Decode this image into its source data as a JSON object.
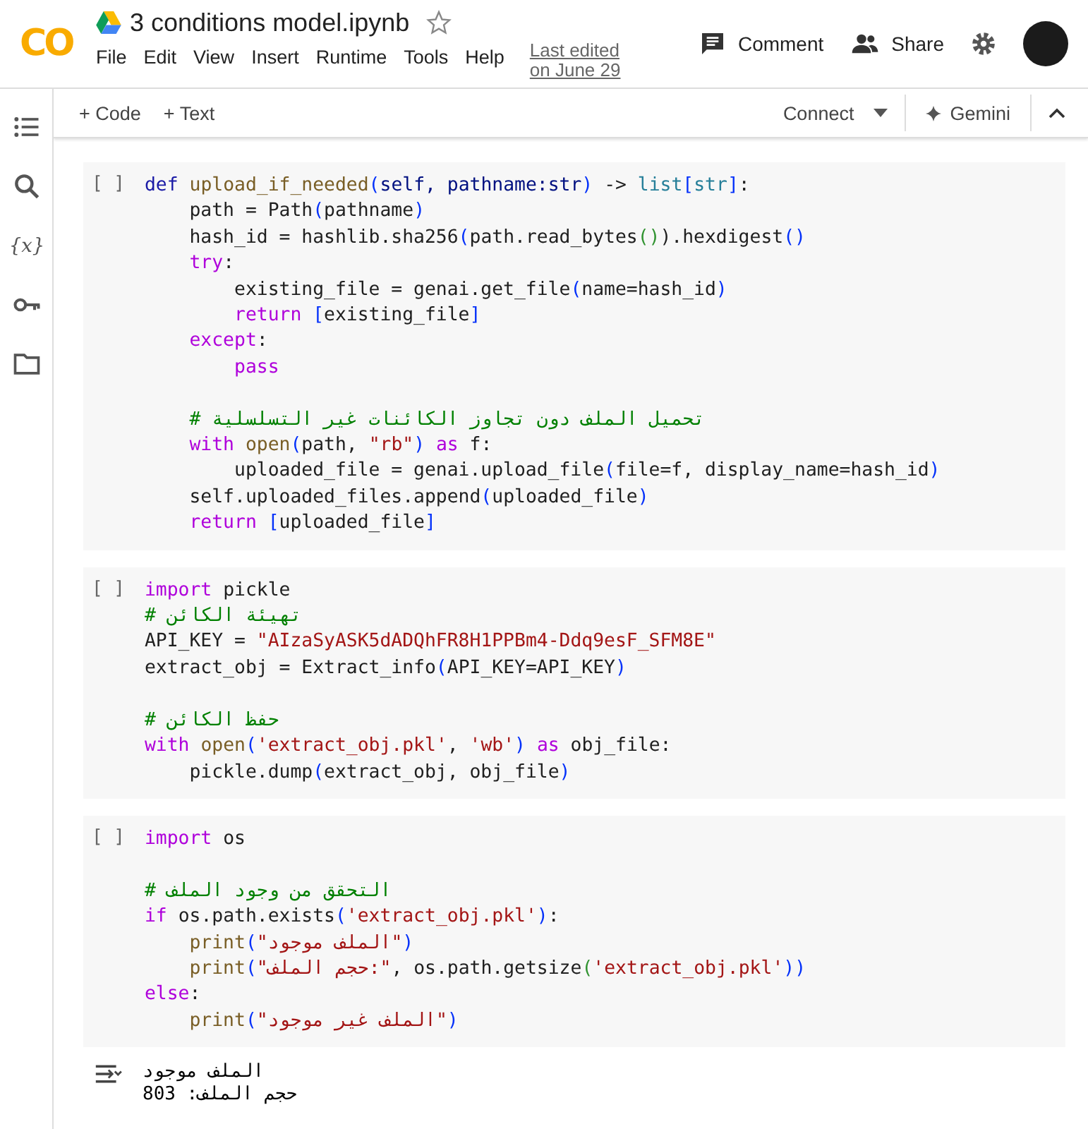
{
  "header": {
    "logo": "CO",
    "title": "3 conditions model.ipynb",
    "starred": false,
    "menu": [
      "File",
      "Edit",
      "View",
      "Insert",
      "Runtime",
      "Tools",
      "Help"
    ],
    "last_edited": [
      "Last edited",
      "on June 29"
    ],
    "comment": "Comment",
    "share": "Share"
  },
  "sidebar": {
    "variables_label": "{x}"
  },
  "toolbar": {
    "add_code": "+ Code",
    "add_text": "+ Text",
    "connect": "Connect",
    "gemini": "Gemini"
  },
  "cells": [
    {
      "run_label": "[ ]",
      "lines": [
        {
          "kind": "code",
          "tokens": [
            {
              "t": "def ",
              "kind": "def"
            },
            {
              "t": "upload_if_needed",
              "kind": "fn"
            },
            {
              "t": "(",
              "kind": "p"
            },
            {
              "t": "self, pathname:str",
              "kind": "var"
            },
            {
              "t": ")",
              "kind": "p"
            },
            {
              "t": " -> ",
              "kind": "plain"
            },
            {
              "t": "list",
              "kind": "type"
            },
            {
              "t": "[",
              "kind": "p"
            },
            {
              "t": "str",
              "kind": "type"
            },
            {
              "t": "]",
              "kind": "p"
            },
            {
              "t": ":",
              "kind": "plain"
            }
          ]
        },
        {
          "kind": "code",
          "tokens": [
            {
              "t": "    path = Path",
              "kind": "plain"
            },
            {
              "t": "(",
              "kind": "p"
            },
            {
              "t": "pathname",
              "kind": "plain"
            },
            {
              "t": ")",
              "kind": "p"
            }
          ]
        },
        {
          "kind": "code",
          "tokens": [
            {
              "t": "    hash_id = hashlib.sha256",
              "kind": "plain"
            },
            {
              "t": "(",
              "kind": "p"
            },
            {
              "t": "path.read_bytes",
              "kind": "plain"
            },
            {
              "t": "()",
              "kind": "p2"
            },
            {
              "t": ").hexdigest",
              "kind": "plain"
            },
            {
              "t": "()",
              "kind": "p"
            }
          ]
        },
        {
          "kind": "code",
          "tokens": [
            {
              "t": "    try",
              "kind": "kw"
            },
            {
              "t": ":",
              "kind": "plain"
            }
          ]
        },
        {
          "kind": "code",
          "tokens": [
            {
              "t": "        existing_file = genai.get_file",
              "kind": "plain"
            },
            {
              "t": "(",
              "kind": "p"
            },
            {
              "t": "name=hash_id",
              "kind": "plain"
            },
            {
              "t": ")",
              "kind": "p"
            }
          ]
        },
        {
          "kind": "code",
          "tokens": [
            {
              "t": "        return ",
              "kind": "kw"
            },
            {
              "t": "[",
              "kind": "p"
            },
            {
              "t": "existing_file",
              "kind": "plain"
            },
            {
              "t": "]",
              "kind": "p"
            }
          ]
        },
        {
          "kind": "code",
          "tokens": [
            {
              "t": "    except",
              "kind": "kw"
            },
            {
              "t": ":",
              "kind": "plain"
            }
          ]
        },
        {
          "kind": "code",
          "tokens": [
            {
              "t": "        pass",
              "kind": "kw"
            }
          ]
        },
        {
          "kind": "blank"
        },
        {
          "kind": "code",
          "tokens": [
            {
              "t": "    # تحميل الملف دون تجاوز الكائنات غير التسلسلية",
              "kind": "com"
            }
          ]
        },
        {
          "kind": "code",
          "tokens": [
            {
              "t": "    with ",
              "kind": "kw"
            },
            {
              "t": "open",
              "kind": "fn"
            },
            {
              "t": "(",
              "kind": "p"
            },
            {
              "t": "path, ",
              "kind": "plain"
            },
            {
              "t": "\"rb\"",
              "kind": "str"
            },
            {
              "t": ")",
              "kind": "p"
            },
            {
              "t": " as ",
              "kind": "kw"
            },
            {
              "t": "f:",
              "kind": "plain"
            }
          ]
        },
        {
          "kind": "code",
          "tokens": [
            {
              "t": "        uploaded_file = genai.upload_file",
              "kind": "plain"
            },
            {
              "t": "(",
              "kind": "p"
            },
            {
              "t": "file=f, display_name=hash_id",
              "kind": "plain"
            },
            {
              "t": ")",
              "kind": "p"
            }
          ]
        },
        {
          "kind": "code",
          "tokens": [
            {
              "t": "    self.uploaded_files.append",
              "kind": "plain"
            },
            {
              "t": "(",
              "kind": "p"
            },
            {
              "t": "uploaded_file",
              "kind": "plain"
            },
            {
              "t": ")",
              "kind": "p"
            }
          ]
        },
        {
          "kind": "code",
          "tokens": [
            {
              "t": "    return ",
              "kind": "kw"
            },
            {
              "t": "[",
              "kind": "p"
            },
            {
              "t": "uploaded_file",
              "kind": "plain"
            },
            {
              "t": "]",
              "kind": "p"
            }
          ]
        }
      ]
    },
    {
      "run_label": "[ ]",
      "lines": [
        {
          "kind": "code",
          "tokens": [
            {
              "t": "import ",
              "kind": "kw"
            },
            {
              "t": "pickle",
              "kind": "plain"
            }
          ]
        },
        {
          "kind": "code",
          "tokens": [
            {
              "t": "# تهيئة الكائن",
              "kind": "com"
            }
          ]
        },
        {
          "kind": "code",
          "tokens": [
            {
              "t": "API_KEY = ",
              "kind": "plain"
            },
            {
              "t": "\"AIzaSyASK5dADQhFR8H1PPBm4-Ddq9esF_SFM8E\"",
              "kind": "str"
            }
          ]
        },
        {
          "kind": "code",
          "tokens": [
            {
              "t": "extract_obj = Extract_info",
              "kind": "plain"
            },
            {
              "t": "(",
              "kind": "p"
            },
            {
              "t": "API_KEY=API_KEY",
              "kind": "plain"
            },
            {
              "t": ")",
              "kind": "p"
            }
          ]
        },
        {
          "kind": "blank"
        },
        {
          "kind": "code",
          "tokens": [
            {
              "t": "# حفظ الكائن",
              "kind": "com"
            }
          ]
        },
        {
          "kind": "code",
          "tokens": [
            {
              "t": "with ",
              "kind": "kw"
            },
            {
              "t": "open",
              "kind": "fn"
            },
            {
              "t": "(",
              "kind": "p"
            },
            {
              "t": "'extract_obj.pkl'",
              "kind": "str"
            },
            {
              "t": ", ",
              "kind": "plain"
            },
            {
              "t": "'wb'",
              "kind": "str"
            },
            {
              "t": ")",
              "kind": "p"
            },
            {
              "t": " as ",
              "kind": "kw"
            },
            {
              "t": "obj_file:",
              "kind": "plain"
            }
          ]
        },
        {
          "kind": "code",
          "tokens": [
            {
              "t": "    pickle.dump",
              "kind": "plain"
            },
            {
              "t": "(",
              "kind": "p"
            },
            {
              "t": "extract_obj, obj_file",
              "kind": "plain"
            },
            {
              "t": ")",
              "kind": "p"
            }
          ]
        }
      ]
    },
    {
      "run_label": "[ ]",
      "lines": [
        {
          "kind": "code",
          "tokens": [
            {
              "t": "import ",
              "kind": "kw"
            },
            {
              "t": "os",
              "kind": "plain"
            }
          ]
        },
        {
          "kind": "blank"
        },
        {
          "kind": "code",
          "tokens": [
            {
              "t": "# التحقق من وجود الملف",
              "kind": "com"
            }
          ]
        },
        {
          "kind": "code",
          "tokens": [
            {
              "t": "if ",
              "kind": "kw"
            },
            {
              "t": "os.path.exists",
              "kind": "plain"
            },
            {
              "t": "(",
              "kind": "p"
            },
            {
              "t": "'extract_obj.pkl'",
              "kind": "str"
            },
            {
              "t": ")",
              "kind": "p"
            },
            {
              "t": ":",
              "kind": "plain"
            }
          ]
        },
        {
          "kind": "code",
          "tokens": [
            {
              "t": "    print",
              "kind": "fn"
            },
            {
              "t": "(",
              "kind": "p"
            },
            {
              "t": "\"الملف موجود\"",
              "kind": "str"
            },
            {
              "t": ")",
              "kind": "p"
            }
          ]
        },
        {
          "kind": "code",
          "tokens": [
            {
              "t": "    print",
              "kind": "fn"
            },
            {
              "t": "(",
              "kind": "p"
            },
            {
              "t": "\"حجم الملف:\"",
              "kind": "str"
            },
            {
              "t": ", os.path.getsize",
              "kind": "plain"
            },
            {
              "t": "(",
              "kind": "p2"
            },
            {
              "t": "'extract_obj.pkl'",
              "kind": "str"
            },
            {
              "t": "))",
              "kind": "p"
            }
          ]
        },
        {
          "kind": "code",
          "tokens": [
            {
              "t": "else",
              "kind": "kw"
            },
            {
              "t": ":",
              "kind": "plain"
            }
          ]
        },
        {
          "kind": "code",
          "tokens": [
            {
              "t": "    print",
              "kind": "fn"
            },
            {
              "t": "(",
              "kind": "p"
            },
            {
              "t": "\"الملف غير موجود\"",
              "kind": "str"
            },
            {
              "t": ")",
              "kind": "p"
            }
          ]
        }
      ],
      "output": [
        "الملف موجود",
        "حجم الملف: 803"
      ]
    }
  ]
}
